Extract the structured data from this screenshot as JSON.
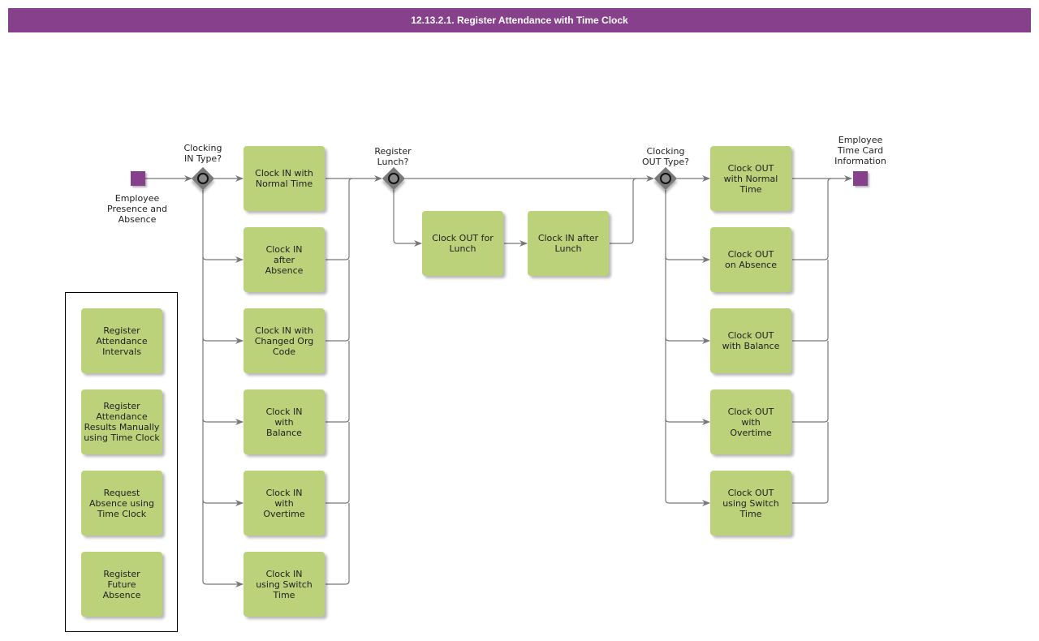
{
  "title": "12.13.2.1. Register Attendance with Time Clock",
  "colors": {
    "title_bar": "#87418c",
    "task_fill": "#bcd27a",
    "event_fill": "#87418c",
    "gateway_fill": "#7a7a7a",
    "connector": "#777777"
  },
  "start_event": {
    "label": "Employee\nPresence and\nAbsence",
    "icon": "start-event-square"
  },
  "end_event": {
    "label": "Employee\nTime Card\nInformation",
    "icon": "end-event-square"
  },
  "gateways": {
    "clock_in": {
      "label": "Clocking\nIN Type?",
      "icon": "inclusive-gateway-icon"
    },
    "lunch": {
      "label": "Register\nLunch?",
      "icon": "inclusive-gateway-icon"
    },
    "clock_out": {
      "label": "Clocking\nOUT Type?",
      "icon": "inclusive-gateway-icon"
    }
  },
  "clock_in_tasks": [
    "Clock IN with\nNormal Time",
    "Clock IN\nafter\nAbsence",
    "Clock IN with\nChanged Org\nCode",
    "Clock IN\nwith\nBalance",
    "Clock IN\nwith\nOvertime",
    "Clock IN\nusing Switch\nTime"
  ],
  "lunch_tasks": [
    "Clock OUT for\nLunch",
    "Clock IN after\nLunch"
  ],
  "clock_out_tasks": [
    "Clock OUT\nwith Normal\nTime",
    "Clock OUT\non Absence",
    "Clock OUT\nwith Balance",
    "Clock OUT\nwith\nOvertime",
    "Clock OUT\nusing Switch\nTime"
  ],
  "related_processes": [
    "Register\nAttendance\nIntervals",
    "Register\nAttendance\nResults Manually\nusing Time Clock",
    "Request\nAbsence using\nTime Clock",
    "Register\nFuture\nAbsence"
  ]
}
